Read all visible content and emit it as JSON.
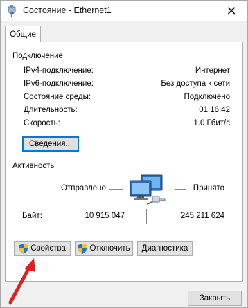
{
  "window": {
    "title": "Состояние - Ethernet1",
    "close_glyph": "✕"
  },
  "tabs": [
    {
      "label": "Общие"
    }
  ],
  "connection": {
    "heading": "Подключение",
    "rows": [
      {
        "label": "IPv4-подключение:",
        "value": "Интернет"
      },
      {
        "label": "IPv6-подключение:",
        "value": "Без доступа к сети"
      },
      {
        "label": "Состояние среды:",
        "value": "Подключено"
      },
      {
        "label": "Длительность:",
        "value": "01:16:42"
      },
      {
        "label": "Скорость:",
        "value": "1.0 Гбит/с"
      }
    ],
    "details_button": "Сведения..."
  },
  "activity": {
    "heading": "Активность",
    "sent_label": "Отправлено",
    "received_label": "Принято",
    "bytes_label": "Байт:",
    "bytes_sent": "10 915 047",
    "bytes_received": "245 211 624"
  },
  "buttons": {
    "properties": "Свойства",
    "disable": "Отключить",
    "diagnose": "Диагностика",
    "close": "Закрыть"
  },
  "icons": {
    "title": "network-plug-icon",
    "network": "network-computers-icon",
    "shield": "uac-shield-icon",
    "annotation": "red-arrow-annotation"
  },
  "colors": {
    "focus_border": "#0078d7",
    "annotation_arrow": "#e02020",
    "shield_blue": "#2a6fd6",
    "shield_yellow": "#f2c21b"
  }
}
